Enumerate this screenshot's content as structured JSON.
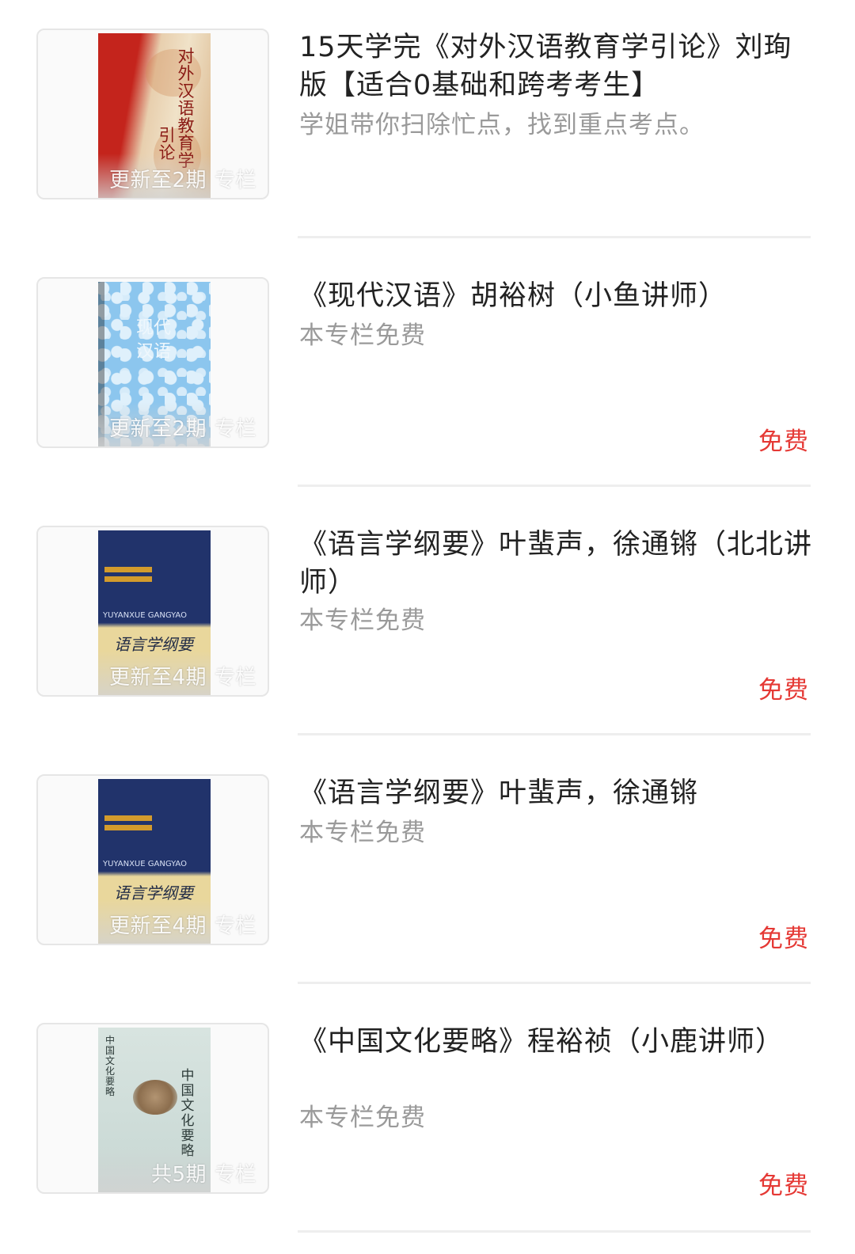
{
  "items": [
    {
      "title": "15天学完《对外汉语教育学引论》刘珣版【适合0基础和跨考考生】",
      "subtitle": "学姐带你扫除忙点，找到重点考点。",
      "thumb_status": "更新至2期",
      "thumb_tag": "专栏",
      "cover_title": "对外汉语教育学引论",
      "price": ""
    },
    {
      "title": "《现代汉语》胡裕树（小鱼讲师）",
      "subtitle": "本专栏免费",
      "thumb_status": "更新至2期",
      "thumb_tag": "专栏",
      "cover_title": "现代汉语",
      "price": "免费"
    },
    {
      "title": "《语言学纲要》叶蜚声，徐通锵（北北讲师）",
      "subtitle": "本专栏免费",
      "thumb_status": "更新至4期",
      "thumb_tag": "专栏",
      "cover_title": "语言学纲要",
      "cover_subtitle": "YUYANXUE GANGYAO",
      "price": "免费"
    },
    {
      "title": "《语言学纲要》叶蜚声，徐通锵",
      "subtitle": "本专栏免费",
      "thumb_status": "更新至4期",
      "thumb_tag": "专栏",
      "cover_title": "语言学纲要",
      "cover_subtitle": "YUYANXUE GANGYAO",
      "price": "免费"
    },
    {
      "title": "《中国文化要略》程裕祯（小鹿讲师）",
      "subtitle": "本专栏免费",
      "thumb_status": "共5期",
      "thumb_tag": "专栏",
      "cover_title": "中国文化要略",
      "price": "免费"
    }
  ]
}
